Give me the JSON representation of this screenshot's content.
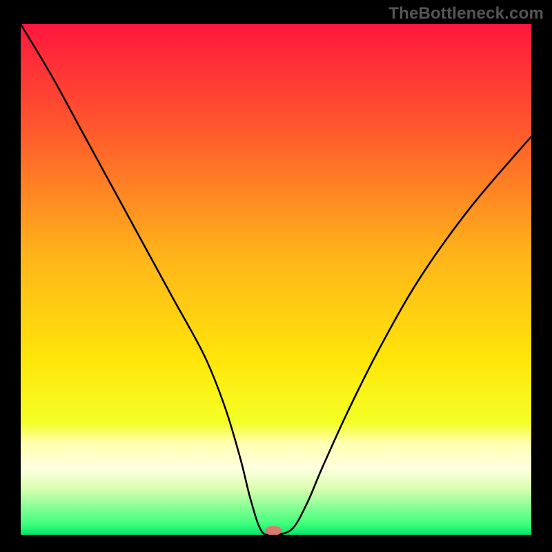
{
  "watermark": "TheBottleneck.com",
  "chart_data": {
    "type": "line",
    "title": "",
    "xlabel": "",
    "ylabel": "",
    "xlim": [
      0,
      100
    ],
    "ylim": [
      0,
      100
    ],
    "x": [
      0,
      6,
      12,
      18,
      24,
      30,
      36,
      40,
      43,
      45,
      47,
      49,
      53,
      56,
      59,
      64,
      70,
      78,
      88,
      100
    ],
    "values": [
      100,
      90,
      79,
      68,
      57,
      46,
      35,
      25,
      15,
      7,
      1,
      0,
      1,
      6,
      13,
      24,
      36,
      50,
      64,
      78
    ],
    "curve_color": "#000000",
    "marker": {
      "x": 49.5,
      "y": 0.8,
      "color": "#d77b6f"
    },
    "background_gradient": {
      "type": "vertical",
      "stops": [
        {
          "offset": 0.0,
          "color": "#ff173e"
        },
        {
          "offset": 0.22,
          "color": "#ff5d2b"
        },
        {
          "offset": 0.45,
          "color": "#ffb31a"
        },
        {
          "offset": 0.66,
          "color": "#ffe60a"
        },
        {
          "offset": 0.78,
          "color": "#f4ff26"
        },
        {
          "offset": 0.82,
          "color": "#ffffaf"
        },
        {
          "offset": 0.87,
          "color": "#ffffe0"
        },
        {
          "offset": 0.91,
          "color": "#d9ffb0"
        },
        {
          "offset": 0.98,
          "color": "#3bff7a"
        },
        {
          "offset": 1.0,
          "color": "#02e46a"
        }
      ]
    }
  }
}
